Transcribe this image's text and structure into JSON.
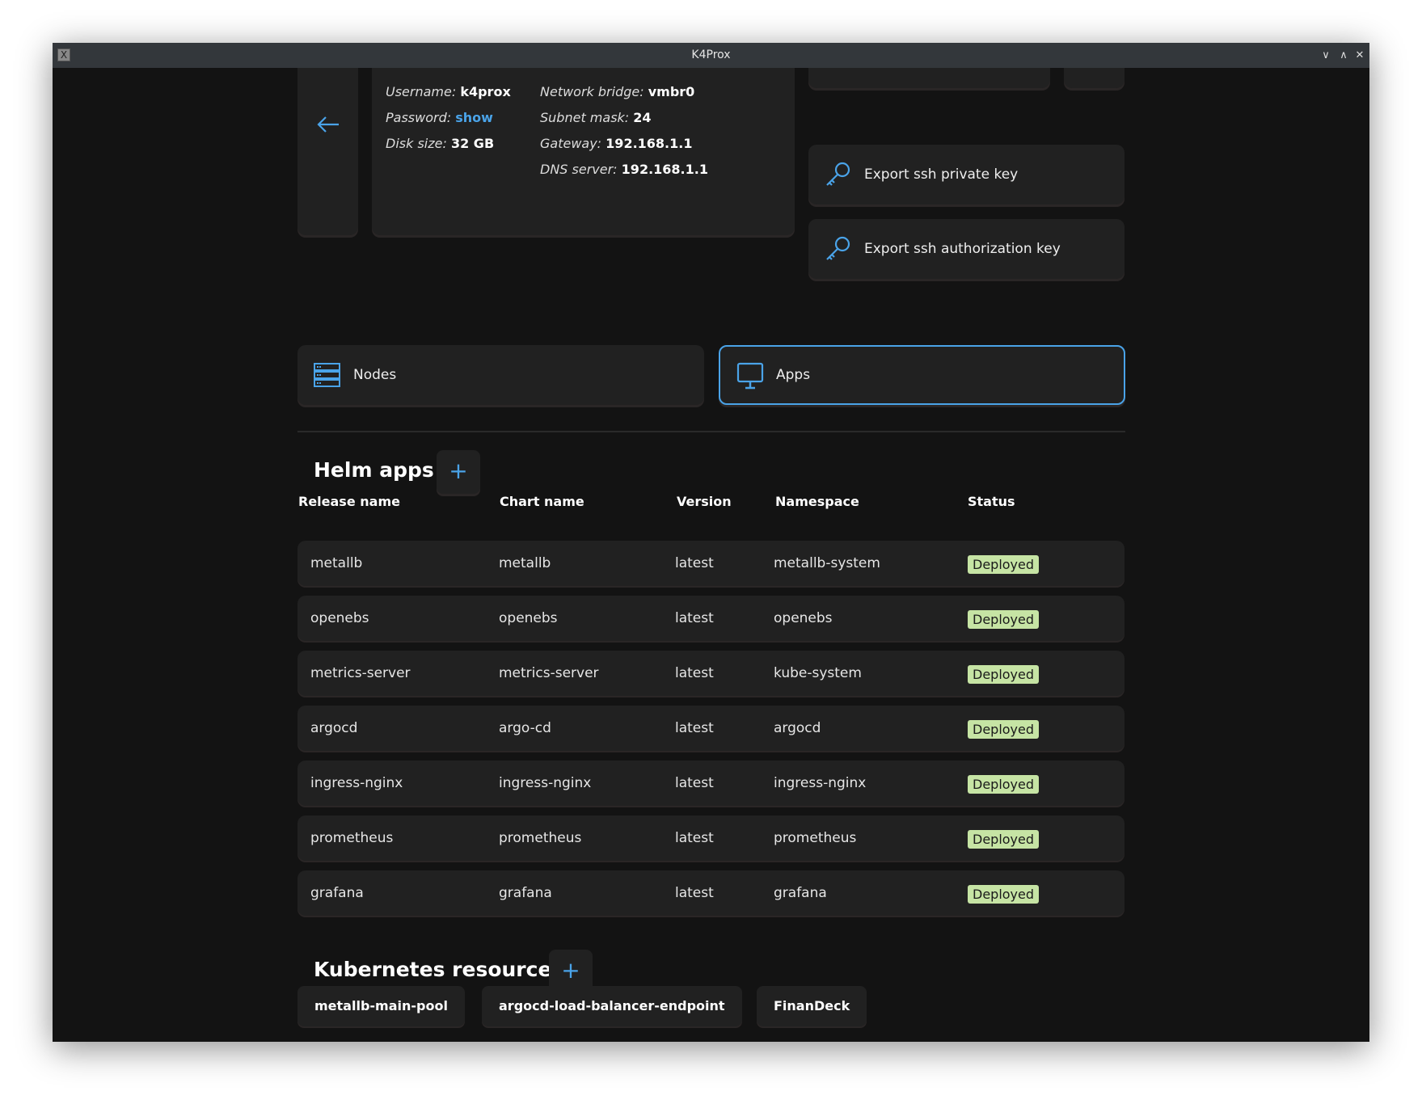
{
  "window": {
    "title": "K4Prox"
  },
  "info": {
    "username_label": "Username:",
    "username": "k4prox",
    "password_label": "Password:",
    "password_action": "show",
    "disk_label": "Disk size:",
    "disk": "32 GB",
    "bridge_label": "Network bridge:",
    "bridge": "vmbr0",
    "mask_label": "Subnet mask:",
    "mask": "24",
    "gateway_label": "Gateway:",
    "gateway": "192.168.1.1",
    "dns_label": "DNS server:",
    "dns": "192.168.1.1"
  },
  "actions": {
    "export_private": "Export ssh private key",
    "export_auth": "Export ssh authorization key"
  },
  "tabs": [
    {
      "label": "Nodes",
      "icon": "server-icon"
    },
    {
      "label": "Apps",
      "icon": "monitor-icon",
      "active": true
    }
  ],
  "helm": {
    "title": "Helm apps",
    "add": "+",
    "columns": [
      "Release name",
      "Chart name",
      "Version",
      "Namespace",
      "Status"
    ],
    "rows": [
      [
        "metallb",
        "metallb",
        "latest",
        "metallb-system",
        "Deployed"
      ],
      [
        "openebs",
        "openebs",
        "latest",
        "openebs",
        "Deployed"
      ],
      [
        "metrics-server",
        "metrics-server",
        "latest",
        "kube-system",
        "Deployed"
      ],
      [
        "argocd",
        "argo-cd",
        "latest",
        "argocd",
        "Deployed"
      ],
      [
        "ingress-nginx",
        "ingress-nginx",
        "latest",
        "ingress-nginx",
        "Deployed"
      ],
      [
        "prometheus",
        "prometheus",
        "latest",
        "prometheus",
        "Deployed"
      ],
      [
        "grafana",
        "grafana",
        "latest",
        "grafana",
        "Deployed"
      ]
    ]
  },
  "k8s": {
    "title": "Kubernetes resources",
    "add": "+",
    "items": [
      "metallb-main-pool",
      "argocd-load-balancer-endpoint",
      "FinanDeck"
    ]
  },
  "colors": {
    "accent": "#4aa3e8",
    "background": "#131313",
    "card": "#212121",
    "badge": "#c6e4a4"
  }
}
